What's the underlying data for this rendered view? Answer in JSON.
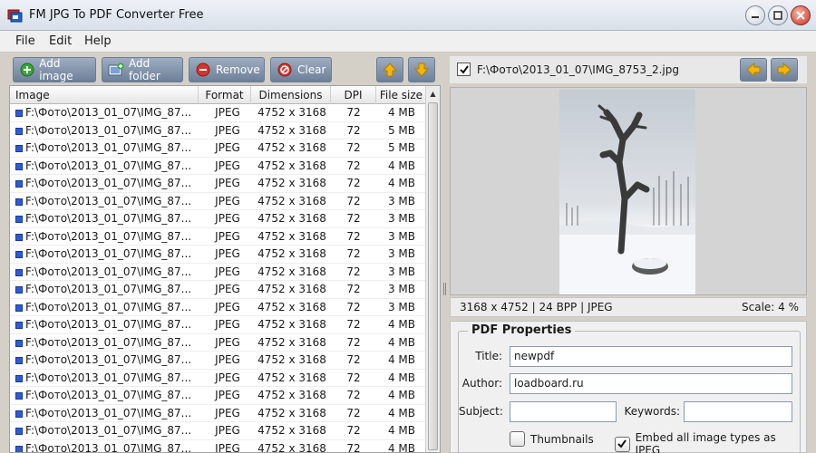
{
  "window": {
    "title": "FM JPG To PDF Converter Free"
  },
  "menu": [
    "File",
    "Edit",
    "Help"
  ],
  "toolbar": {
    "add_image": "Add image",
    "add_folder": "Add folder",
    "remove": "Remove",
    "clear": "Clear"
  },
  "table": {
    "columns": [
      "Image",
      "Format",
      "Dimensions",
      "DPI",
      "File size"
    ],
    "rows": [
      [
        "F:\\Фото\\2013_01_07\\IMG_87...",
        "JPEG",
        "4752 x 3168",
        "72",
        "4 MB"
      ],
      [
        "F:\\Фото\\2013_01_07\\IMG_87...",
        "JPEG",
        "4752 x 3168",
        "72",
        "5 MB"
      ],
      [
        "F:\\Фото\\2013_01_07\\IMG_87...",
        "JPEG",
        "4752 x 3168",
        "72",
        "5 MB"
      ],
      [
        "F:\\Фото\\2013_01_07\\IMG_87...",
        "JPEG",
        "4752 x 3168",
        "72",
        "4 MB"
      ],
      [
        "F:\\Фото\\2013_01_07\\IMG_87...",
        "JPEG",
        "4752 x 3168",
        "72",
        "4 MB"
      ],
      [
        "F:\\Фото\\2013_01_07\\IMG_87...",
        "JPEG",
        "4752 x 3168",
        "72",
        "3 MB"
      ],
      [
        "F:\\Фото\\2013_01_07\\IMG_87...",
        "JPEG",
        "4752 x 3168",
        "72",
        "3 MB"
      ],
      [
        "F:\\Фото\\2013_01_07\\IMG_87...",
        "JPEG",
        "4752 x 3168",
        "72",
        "3 MB"
      ],
      [
        "F:\\Фото\\2013_01_07\\IMG_87...",
        "JPEG",
        "4752 x 3168",
        "72",
        "3 MB"
      ],
      [
        "F:\\Фото\\2013_01_07\\IMG_87...",
        "JPEG",
        "4752 x 3168",
        "72",
        "3 MB"
      ],
      [
        "F:\\Фото\\2013_01_07\\IMG_87...",
        "JPEG",
        "4752 x 3168",
        "72",
        "3 MB"
      ],
      [
        "F:\\Фото\\2013_01_07\\IMG_87...",
        "JPEG",
        "4752 x 3168",
        "72",
        "3 MB"
      ],
      [
        "F:\\Фото\\2013_01_07\\IMG_87...",
        "JPEG",
        "4752 x 3168",
        "72",
        "4 MB"
      ],
      [
        "F:\\Фото\\2013_01_07\\IMG_87...",
        "JPEG",
        "4752 x 3168",
        "72",
        "4 MB"
      ],
      [
        "F:\\Фото\\2013_01_07\\IMG_87...",
        "JPEG",
        "4752 x 3168",
        "72",
        "4 MB"
      ],
      [
        "F:\\Фото\\2013_01_07\\IMG_87...",
        "JPEG",
        "4752 x 3168",
        "72",
        "4 MB"
      ],
      [
        "F:\\Фото\\2013_01_07\\IMG_87...",
        "JPEG",
        "4752 x 3168",
        "72",
        "4 MB"
      ],
      [
        "F:\\Фото\\2013_01_07\\IMG_87...",
        "JPEG",
        "4752 x 3168",
        "72",
        "4 MB"
      ],
      [
        "F:\\Фото\\2013_01_07\\IMG_87...",
        "JPEG",
        "4752 x 3168",
        "72",
        "4 MB"
      ],
      [
        "F:\\Фото\\2013_01_07\\IMG_87...",
        "JPEG",
        "4752 x 3168",
        "72",
        "4 MB"
      ]
    ]
  },
  "preview": {
    "path": "F:\\Фото\\2013_01_07\\IMG_8753_2.jpg",
    "checked": true,
    "info": "3168 x 4752  |  24 BPP  |  JPEG",
    "scale": "Scale: 4 %"
  },
  "pdf_properties": {
    "title": "PDF Properties",
    "title_label": "Title:",
    "title_value": "newpdf",
    "author_label": "Author:",
    "author_value": "loadboard.ru",
    "subject_label": "Subject:",
    "subject_value": "",
    "keywords_label": "Keywords:",
    "keywords_value": "",
    "thumbnails_label": "Thumbnails",
    "thumbnails_checked": false,
    "embed_label": "Embed all image types as JPEG",
    "embed_checked": true
  },
  "colors": {
    "toolbar_button": "#8597b0",
    "add_icon": "#3aa53a",
    "remove_icon": "#d9342b",
    "arrow_icon": "#f2b705"
  }
}
